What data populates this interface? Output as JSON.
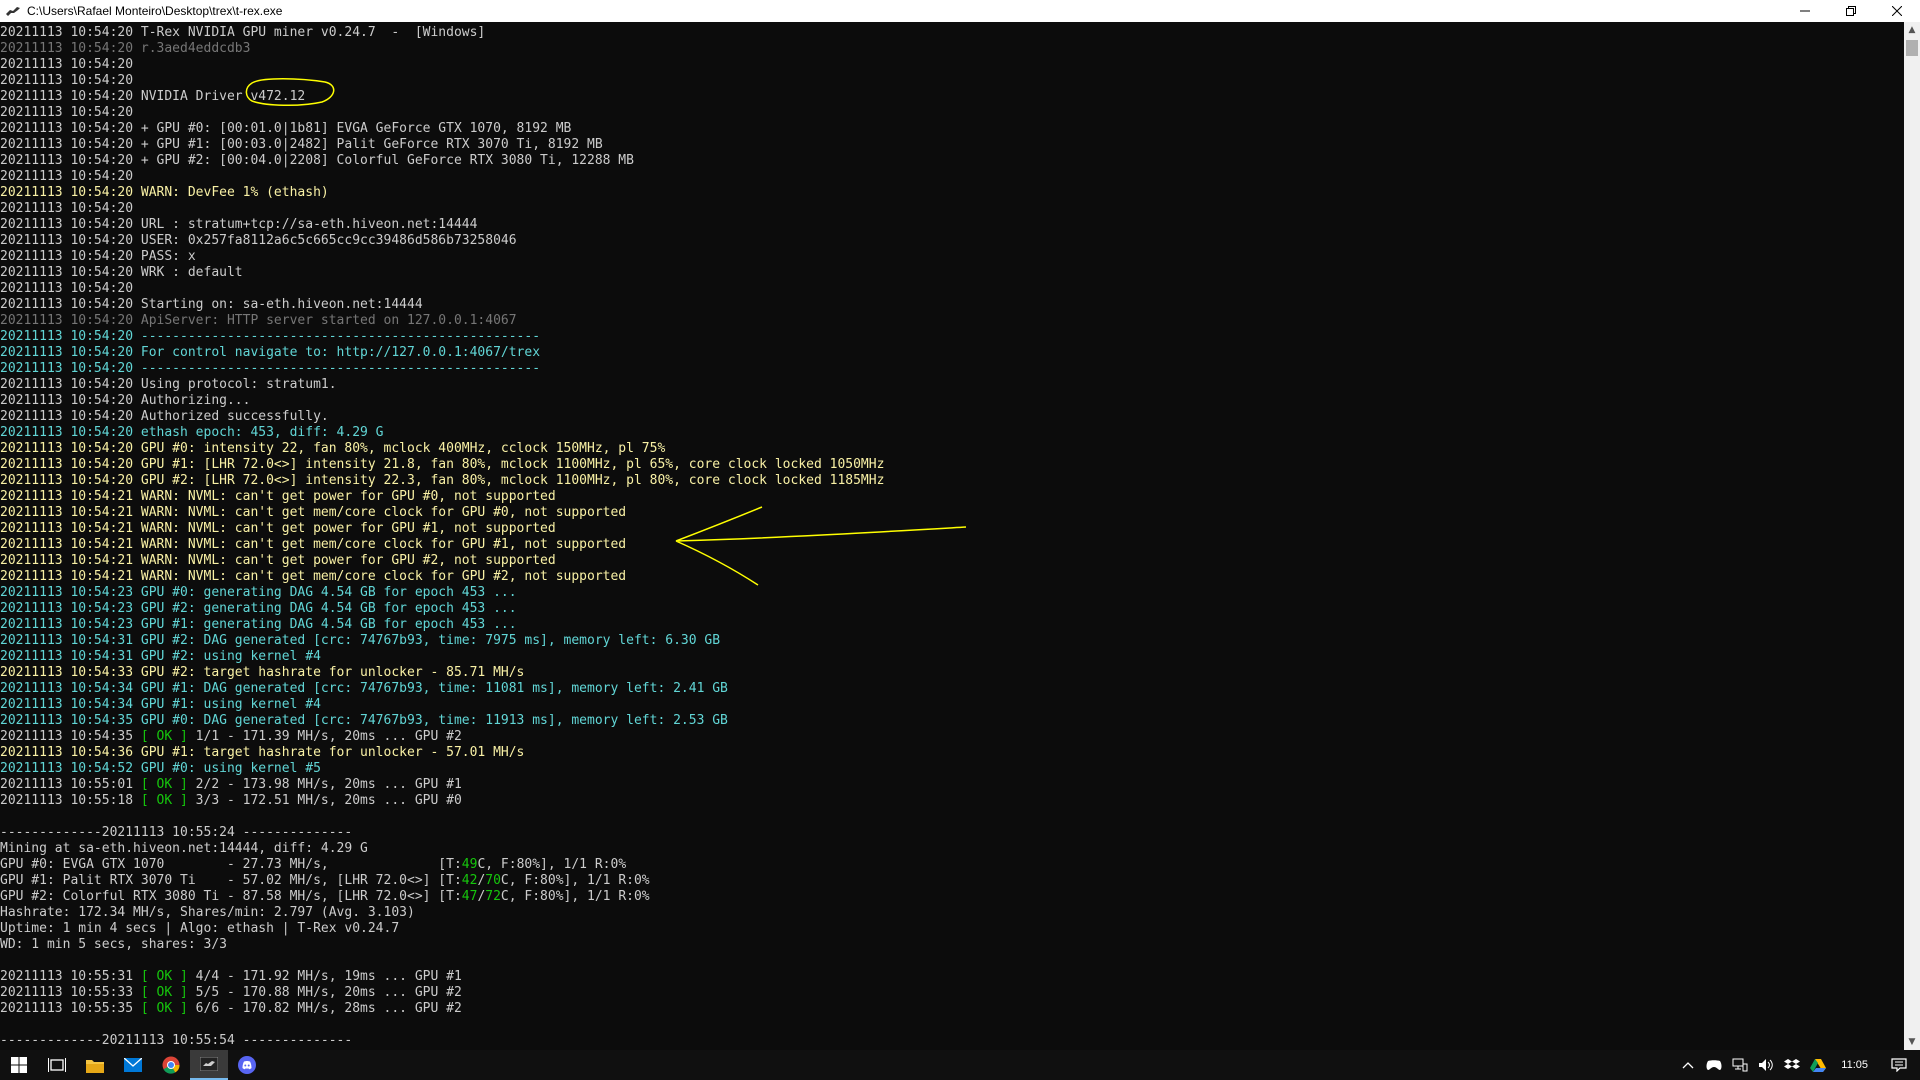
{
  "window": {
    "title": "C:\\Users\\Rafael Monteiro\\Desktop\\trex\\t-rex.exe",
    "controls": {
      "minimize": "minimize-icon",
      "maximize": "restore-icon",
      "close": "close-icon"
    }
  },
  "colors": {
    "background": "#0c0c0c",
    "default_text": "#cccccc",
    "gray": "#767676",
    "yellow": "#f9f1a5",
    "cyan": "#61d6d6",
    "green": "#16c60c",
    "annotation": "#ffff00"
  },
  "terminal": {
    "lines": [
      [
        {
          "t": "20211113 10:54:20 T-Rex NVIDIA GPU miner v0.24.7  -  [Windows]",
          "c": "white"
        }
      ],
      [
        {
          "t": "20211113 10:54:20 r.3aed4eddcdb3",
          "c": "gray"
        }
      ],
      [
        {
          "t": "20211113 10:54:20",
          "c": "white"
        }
      ],
      [
        {
          "t": "20211113 10:54:20",
          "c": "white"
        }
      ],
      [
        {
          "t": "20211113 10:54:20 NVIDIA Driver v472.12",
          "c": "white"
        }
      ],
      [
        {
          "t": "20211113 10:54:20",
          "c": "white"
        }
      ],
      [
        {
          "t": "20211113 10:54:20 + GPU #0: [00:01.0|1b81] EVGA GeForce GTX 1070, 8192 MB",
          "c": "white"
        }
      ],
      [
        {
          "t": "20211113 10:54:20 + GPU #1: [00:03.0|2482] Palit GeForce RTX 3070 Ti, 8192 MB",
          "c": "white"
        }
      ],
      [
        {
          "t": "20211113 10:54:20 + GPU #2: [00:04.0|2208] Colorful GeForce RTX 3080 Ti, 12288 MB",
          "c": "white"
        }
      ],
      [
        {
          "t": "20211113 10:54:20",
          "c": "white"
        }
      ],
      [
        {
          "t": "20211113 10:54:20 WARN: DevFee 1% (ethash)",
          "c": "yellow"
        }
      ],
      [
        {
          "t": "20211113 10:54:20",
          "c": "white"
        }
      ],
      [
        {
          "t": "20211113 10:54:20 URL : stratum+tcp://sa-eth.hiveon.net:14444",
          "c": "white"
        }
      ],
      [
        {
          "t": "20211113 10:54:20 USER: 0x257fa8112a6c5c665cc9cc39486d586b73258046",
          "c": "white"
        }
      ],
      [
        {
          "t": "20211113 10:54:20 PASS: x",
          "c": "white"
        }
      ],
      [
        {
          "t": "20211113 10:54:20 WRK : default",
          "c": "white"
        }
      ],
      [
        {
          "t": "20211113 10:54:20",
          "c": "white"
        }
      ],
      [
        {
          "t": "20211113 10:54:20 Starting on: sa-eth.hiveon.net:14444",
          "c": "white"
        }
      ],
      [
        {
          "t": "20211113 10:54:20 ApiServer: HTTP server started on 127.0.0.1:4067",
          "c": "gray"
        }
      ],
      [
        {
          "t": "20211113 10:54:20 ---------------------------------------------------",
          "c": "cyan"
        }
      ],
      [
        {
          "t": "20211113 10:54:20 For control navigate to: http://127.0.0.1:4067/trex",
          "c": "cyan"
        }
      ],
      [
        {
          "t": "20211113 10:54:20 ---------------------------------------------------",
          "c": "cyan"
        }
      ],
      [
        {
          "t": "20211113 10:54:20 Using protocol: stratum1.",
          "c": "white"
        }
      ],
      [
        {
          "t": "20211113 10:54:20 Authorizing...",
          "c": "white"
        }
      ],
      [
        {
          "t": "20211113 10:54:20 Authorized successfully.",
          "c": "white"
        }
      ],
      [
        {
          "t": "20211113 10:54:20 ethash epoch: 453, diff: 4.29 G",
          "c": "cyan"
        }
      ],
      [
        {
          "t": "20211113 10:54:20 GPU #0: intensity 22, fan 80%, mclock 400MHz, cclock 150MHz, pl 75%",
          "c": "yellow"
        }
      ],
      [
        {
          "t": "20211113 10:54:20 GPU #1: [LHR 72.0<>] intensity 21.8, fan 80%, mclock 1100MHz, pl 65%, core clock locked 1050MHz",
          "c": "yellow"
        }
      ],
      [
        {
          "t": "20211113 10:54:20 GPU #2: [LHR 72.0<>] intensity 22.3, fan 80%, mclock 1100MHz, pl 80%, core clock locked 1185MHz",
          "c": "yellow"
        }
      ],
      [
        {
          "t": "20211113 10:54:21 WARN: NVML: can't get power for GPU #0, not supported",
          "c": "yellow"
        }
      ],
      [
        {
          "t": "20211113 10:54:21 WARN: NVML: can't get mem/core clock for GPU #0, not supported",
          "c": "yellow"
        }
      ],
      [
        {
          "t": "20211113 10:54:21 WARN: NVML: can't get power for GPU #1, not supported",
          "c": "yellow"
        }
      ],
      [
        {
          "t": "20211113 10:54:21 WARN: NVML: can't get mem/core clock for GPU #1, not supported",
          "c": "yellow"
        }
      ],
      [
        {
          "t": "20211113 10:54:21 WARN: NVML: can't get power for GPU #2, not supported",
          "c": "yellow"
        }
      ],
      [
        {
          "t": "20211113 10:54:21 WARN: NVML: can't get mem/core clock for GPU #2, not supported",
          "c": "yellow"
        }
      ],
      [
        {
          "t": "20211113 10:54:23 GPU #0: generating DAG 4.54 GB for epoch 453 ...",
          "c": "cyan"
        }
      ],
      [
        {
          "t": "20211113 10:54:23 GPU #2: generating DAG 4.54 GB for epoch 453 ...",
          "c": "cyan"
        }
      ],
      [
        {
          "t": "20211113 10:54:23 GPU #1: generating DAG 4.54 GB for epoch 453 ...",
          "c": "cyan"
        }
      ],
      [
        {
          "t": "20211113 10:54:31 GPU #2: DAG generated [crc: 74767b93, time: 7975 ms], memory left: 6.30 GB",
          "c": "cyan"
        }
      ],
      [
        {
          "t": "20211113 10:54:31 GPU #2: using kernel #4",
          "c": "cyan"
        }
      ],
      [
        {
          "t": "20211113 10:54:33 GPU #2: target hashrate for unlocker - 85.71 MH/s",
          "c": "yellow"
        }
      ],
      [
        {
          "t": "20211113 10:54:34 GPU #1: DAG generated [crc: 74767b93, time: 11081 ms], memory left: 2.41 GB",
          "c": "cyan"
        }
      ],
      [
        {
          "t": "20211113 10:54:34 GPU #1: using kernel #4",
          "c": "cyan"
        }
      ],
      [
        {
          "t": "20211113 10:54:35 GPU #0: DAG generated [crc: 74767b93, time: 11913 ms], memory left: 2.53 GB",
          "c": "cyan"
        }
      ],
      [
        {
          "t": "20211113 10:54:35 ",
          "c": "white"
        },
        {
          "t": "[ OK ]",
          "c": "green"
        },
        {
          "t": " 1/1 - 171.39 MH/s, 20ms ... GPU #2",
          "c": "white"
        }
      ],
      [
        {
          "t": "20211113 10:54:36 GPU #1: target hashrate for unlocker - 57.01 MH/s",
          "c": "yellow"
        }
      ],
      [
        {
          "t": "20211113 10:54:52 GPU #0: using kernel #5",
          "c": "cyan"
        }
      ],
      [
        {
          "t": "20211113 10:55:01 ",
          "c": "white"
        },
        {
          "t": "[ OK ]",
          "c": "green"
        },
        {
          "t": " 2/2 - 173.98 MH/s, 20ms ... GPU #1",
          "c": "white"
        }
      ],
      [
        {
          "t": "20211113 10:55:18 ",
          "c": "white"
        },
        {
          "t": "[ OK ]",
          "c": "green"
        },
        {
          "t": " 3/3 - 172.51 MH/s, 20ms ... GPU #0",
          "c": "white"
        }
      ],
      [
        {
          "t": "",
          "c": "white"
        }
      ],
      [
        {
          "t": "-------------20211113 10:55:24 --------------",
          "c": "white"
        }
      ],
      [
        {
          "t": "Mining at sa-eth.hiveon.net:14444, diff: 4.29 G",
          "c": "white"
        }
      ],
      [
        {
          "t": "GPU #0: EVGA GTX 1070        - 27.73 MH/s,              [T:",
          "c": "white"
        },
        {
          "t": "49",
          "c": "green"
        },
        {
          "t": "C, F:80%], 1/1 R:0%",
          "c": "white"
        }
      ],
      [
        {
          "t": "GPU #1: Palit RTX 3070 Ti    - 57.02 MH/s, [LHR 72.0<>] [T:",
          "c": "white"
        },
        {
          "t": "42",
          "c": "green"
        },
        {
          "t": "/",
          "c": "white"
        },
        {
          "t": "70",
          "c": "green"
        },
        {
          "t": "C, F:80%], 1/1 R:0%",
          "c": "white"
        }
      ],
      [
        {
          "t": "GPU #2: Colorful RTX 3080 Ti - 87.58 MH/s, [LHR 72.0<>] [T:",
          "c": "white"
        },
        {
          "t": "47",
          "c": "green"
        },
        {
          "t": "/",
          "c": "white"
        },
        {
          "t": "72",
          "c": "green"
        },
        {
          "t": "C, F:80%], 1/1 R:0%",
          "c": "white"
        }
      ],
      [
        {
          "t": "Hashrate: 172.34 MH/s, Shares/min: 2.797 (Avg. 3.103)",
          "c": "white"
        }
      ],
      [
        {
          "t": "Uptime: 1 min 4 secs | Algo: ethash | T-Rex v0.24.7",
          "c": "white"
        }
      ],
      [
        {
          "t": "WD: 1 min 5 secs, shares: 3/3",
          "c": "white"
        }
      ],
      [
        {
          "t": "",
          "c": "white"
        }
      ],
      [
        {
          "t": "20211113 10:55:31 ",
          "c": "white"
        },
        {
          "t": "[ OK ]",
          "c": "green"
        },
        {
          "t": " 4/4 - 171.92 MH/s, 19ms ... GPU #1",
          "c": "white"
        }
      ],
      [
        {
          "t": "20211113 10:55:33 ",
          "c": "white"
        },
        {
          "t": "[ OK ]",
          "c": "green"
        },
        {
          "t": " 5/5 - 170.88 MH/s, 20ms ... GPU #2",
          "c": "white"
        }
      ],
      [
        {
          "t": "20211113 10:55:35 ",
          "c": "white"
        },
        {
          "t": "[ OK ]",
          "c": "green"
        },
        {
          "t": " 6/6 - 170.82 MH/s, 28ms ... GPU #2",
          "c": "white"
        }
      ],
      [
        {
          "t": "",
          "c": "white"
        }
      ],
      [
        {
          "t": "-------------20211113 10:55:54 --------------",
          "c": "white"
        }
      ]
    ]
  },
  "taskbar": {
    "pinned": [
      "windows-start-icon",
      "task-view-icon",
      "file-explorer-icon",
      "mail-icon",
      "chrome-icon",
      "terminal-app-icon",
      "discord-icon"
    ],
    "tray": [
      "chevron-up-icon",
      "game-controller-icon",
      "network-icon",
      "volume-icon",
      "dropbox-icon",
      "google-drive-icon"
    ],
    "clock": "11:05"
  }
}
